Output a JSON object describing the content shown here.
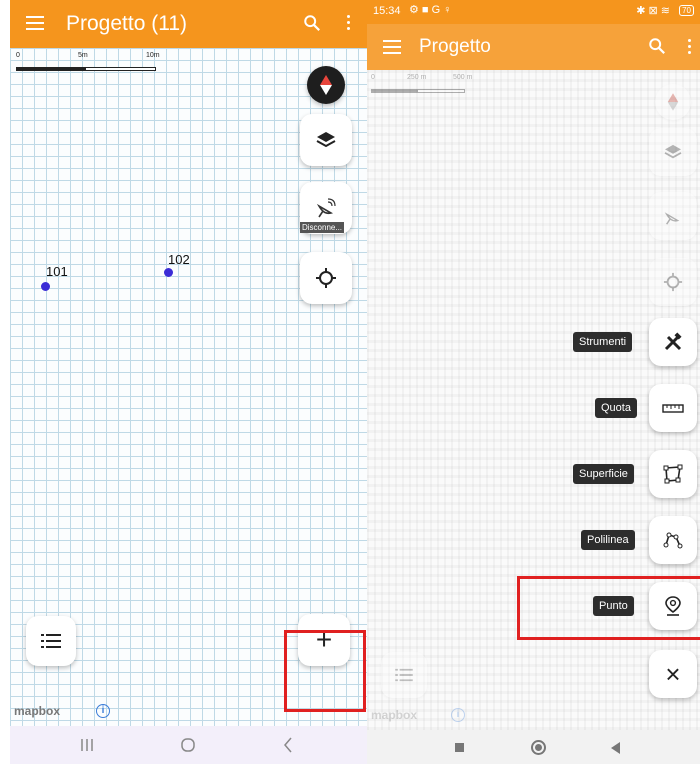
{
  "left": {
    "title": "Progetto (11)",
    "scale": {
      "labels": [
        "0",
        "5m",
        "10m"
      ]
    },
    "points": [
      {
        "label": "101"
      },
      {
        "label": "102"
      }
    ],
    "gnss_status": "Disconne...",
    "add_label": "+",
    "attribution": "mapbox",
    "info": "i"
  },
  "right": {
    "status": {
      "time": "15:34",
      "battery": "70"
    },
    "title": "Progetto",
    "scale": {
      "labels": [
        "0",
        "250 m",
        "500 m"
      ]
    },
    "menu": [
      {
        "label": "Strumenti",
        "icon": "tools-icon"
      },
      {
        "label": "Quota",
        "icon": "ruler-icon"
      },
      {
        "label": "Superficie",
        "icon": "polygon-icon"
      },
      {
        "label": "Polilinea",
        "icon": "polyline-icon"
      },
      {
        "label": "Punto",
        "icon": "map-pin-icon"
      }
    ],
    "close_label": "×",
    "attribution": "mapbox",
    "info": "i"
  },
  "colors": {
    "primary": "#f5951d",
    "point": "#3b2cd6",
    "highlight": "#e02020"
  }
}
